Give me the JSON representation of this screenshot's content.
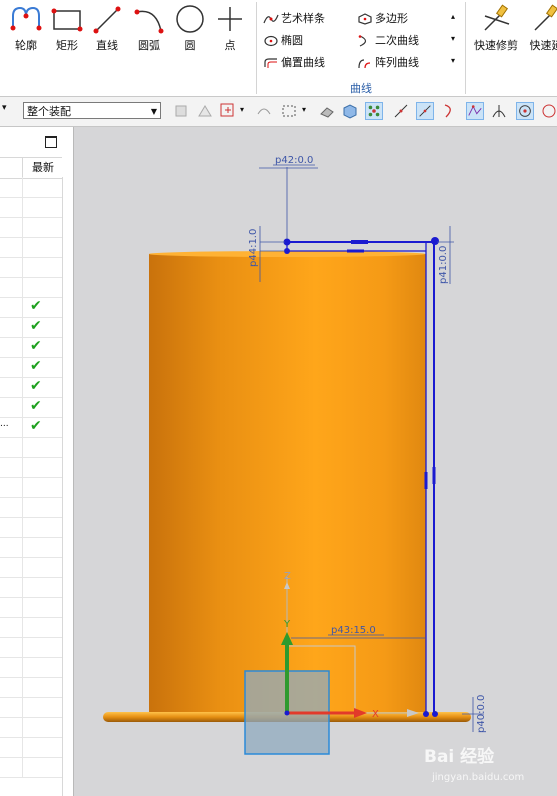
{
  "ribbon": {
    "tools": [
      {
        "label": "轮廓",
        "icon": "profile-icon"
      },
      {
        "label": "矩形",
        "icon": "rectangle-icon"
      },
      {
        "label": "直线",
        "icon": "line-icon"
      },
      {
        "label": "圆弧",
        "icon": "arc-icon"
      },
      {
        "label": "圆",
        "icon": "circle-icon"
      },
      {
        "label": "点",
        "icon": "point-icon"
      }
    ],
    "curve_group": {
      "title": "曲线",
      "items": [
        {
          "label": "艺术样条",
          "icon": "studio-spline-icon"
        },
        {
          "label": "多边形",
          "icon": "polygon-icon"
        },
        {
          "label": "椭圆",
          "icon": "ellipse-icon"
        },
        {
          "label": "二次曲线",
          "icon": "conic-icon"
        },
        {
          "label": "偏置曲线",
          "icon": "offset-curve-icon"
        },
        {
          "label": "阵列曲线",
          "icon": "pattern-curve-icon"
        }
      ]
    },
    "edit_tools": [
      {
        "label": "快速修剪",
        "icon": "quick-trim-icon"
      },
      {
        "label": "快速延",
        "icon": "quick-extend-icon"
      }
    ]
  },
  "toolbar": {
    "selection_filter": "整个装配"
  },
  "navigator": {
    "column_header": "最新",
    "checked_rows": [
      6,
      7,
      8,
      9,
      10,
      11,
      12
    ],
    "row_count": 30,
    "truncated_mark": "..."
  },
  "viewport": {
    "dimensions": {
      "p42": "p42:0.0",
      "p44": "p44:1.0",
      "p41": "p41:0.0",
      "p43": "p43:15.0",
      "p40": "p40:0.0"
    },
    "axes": {
      "z": "Z",
      "y": "Y",
      "x": "X"
    }
  },
  "colors": {
    "cylinder_dark": "#c9720c",
    "cylinder_light": "#ffa61a",
    "sketch_blue": "#1a1ad0",
    "dimension_blue": "#3e56a8",
    "check_green": "#1ea01e"
  },
  "watermark": {
    "brand": "Bai 经验",
    "url": "jingyan.baidu.com"
  }
}
